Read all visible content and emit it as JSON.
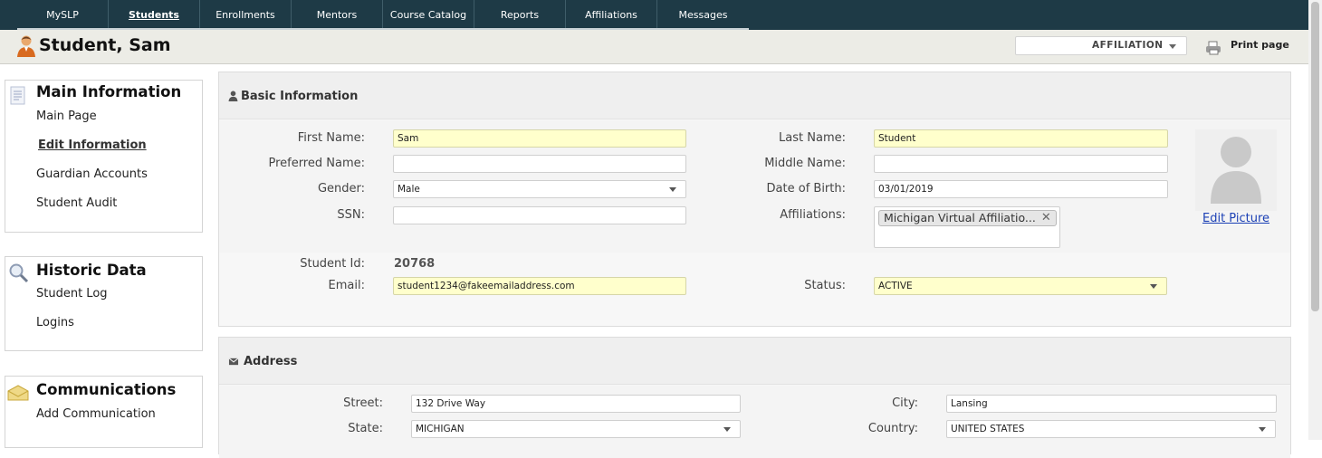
{
  "nav": {
    "tabs": [
      {
        "label": "MySLP"
      },
      {
        "label": "Students"
      },
      {
        "label": "Enrollments"
      },
      {
        "label": "Mentors"
      },
      {
        "label": "Course Catalog"
      },
      {
        "label": "Reports"
      },
      {
        "label": "Affiliations"
      },
      {
        "label": "Messages"
      }
    ],
    "active_tab": "Students"
  },
  "header": {
    "title": "Student, Sam",
    "affiliation_select": "AFFILIATION",
    "print_label": "Print page"
  },
  "sidebar": {
    "main": {
      "title": "Main Information",
      "links": [
        "Main Page",
        "Edit Information",
        "Guardian Accounts",
        "Student Audit"
      ],
      "current": "Edit Information"
    },
    "historic": {
      "title": "Historic Data",
      "links": [
        "Student Log",
        "Logins"
      ]
    },
    "communications": {
      "title": "Communications",
      "links": [
        "Add Communication"
      ]
    }
  },
  "basic": {
    "title": "Basic Information",
    "fields": {
      "first_name": {
        "label": "First Name:",
        "value": "Sam"
      },
      "last_name": {
        "label": "Last Name:",
        "value": "Student"
      },
      "preferred_name": {
        "label": "Preferred Name:",
        "value": ""
      },
      "middle_name": {
        "label": "Middle Name:",
        "value": ""
      },
      "gender": {
        "label": "Gender:",
        "value": "Male"
      },
      "dob": {
        "label": "Date of Birth:",
        "value": "03/01/2019"
      },
      "ssn": {
        "label": "SSN:",
        "value": ""
      },
      "affiliations": {
        "label": "Affiliations:",
        "tag": "Michigan Virtual Affiliatio..."
      },
      "student_id": {
        "label": "Student Id:",
        "value": "20768"
      },
      "email": {
        "label": "Email:",
        "value": "student1234@fakeemailaddress.com"
      },
      "status": {
        "label": "Status:",
        "value": "ACTIVE"
      }
    },
    "edit_picture": "Edit Picture"
  },
  "address": {
    "title": "Address",
    "fields": {
      "street": {
        "label": "Street:",
        "value": "132 Drive Way"
      },
      "city": {
        "label": "City:",
        "value": "Lansing"
      },
      "state": {
        "label": "State:",
        "value": "MICHIGAN"
      },
      "country": {
        "label": "Country:",
        "value": "UNITED STATES"
      }
    }
  }
}
